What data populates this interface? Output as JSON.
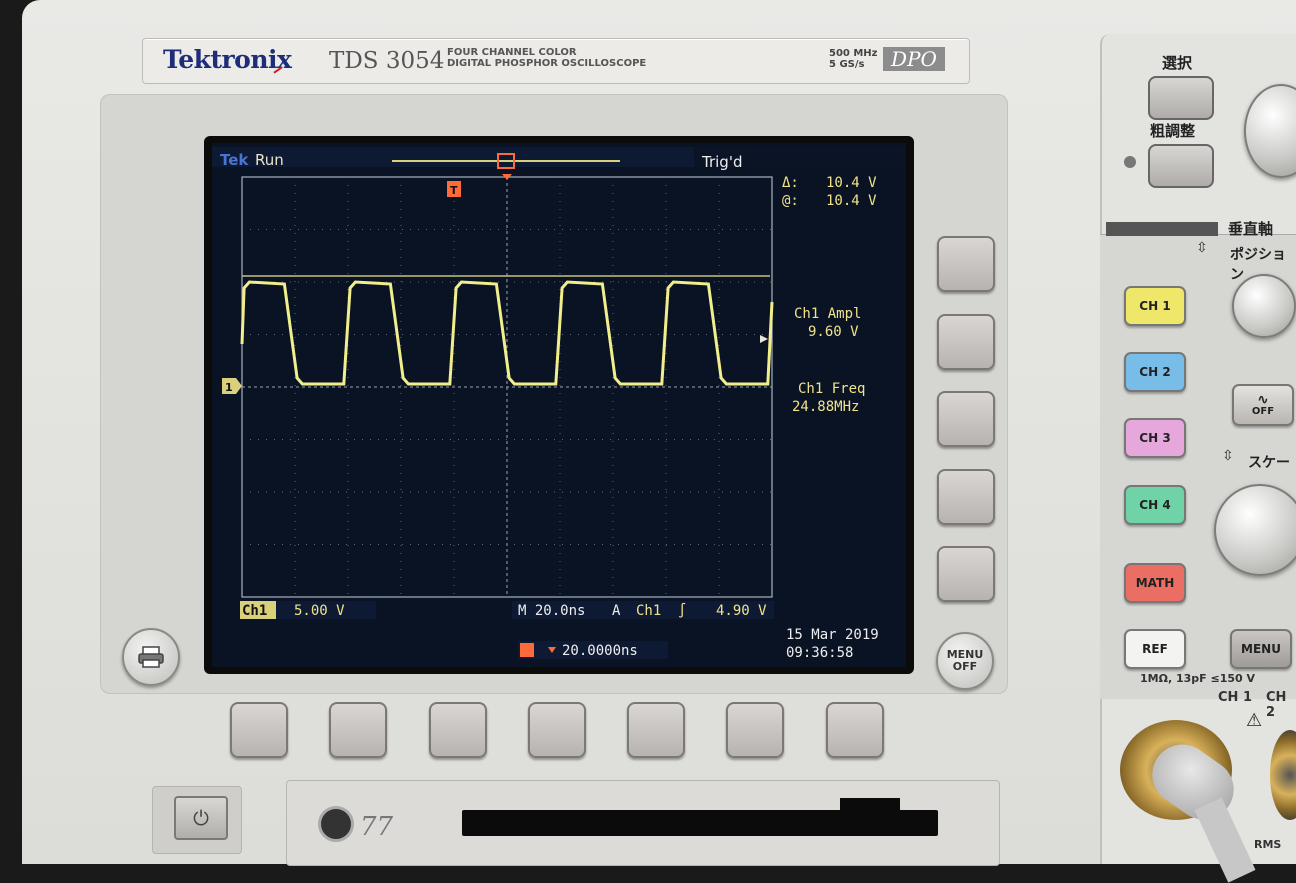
{
  "device": {
    "brand": "Tektronix",
    "model": "TDS 3054",
    "description_line1": "FOUR CHANNEL COLOR",
    "description_line2": "DIGITAL PHOSPHOR OSCILLOSCOPE",
    "spec_line1": "500 MHz",
    "spec_line2": "5 GS/s",
    "badge": "DPO"
  },
  "screen": {
    "brand": "Tek",
    "acq_state": "Run",
    "trigger_state": "Trig'd",
    "trigger_marker": "T",
    "channel_marker": "1",
    "delta_label": "Δ:",
    "delta_value": "10.4 V",
    "at_label": "@:",
    "at_value": "10.4 V",
    "meas1_label": "Ch1 Ampl",
    "meas1_value": "9.60 V",
    "meas2_label": "Ch1 Freq",
    "meas2_value": "24.88MHz",
    "ch1_label": "Ch1",
    "ch1_scale": "5.00 V",
    "timebase": "M 20.0ns",
    "trig_source_prefix": "A",
    "trig_source": "Ch1",
    "trig_slope": "∫",
    "trig_level": "4.90 V",
    "trig_position": "20.0000ns",
    "date": "15 Mar 2019",
    "time": "09:36:58",
    "colors": {
      "trace": "#f1ee8c",
      "text": "#f0e38a",
      "grid": "#7a8090",
      "bg": "#0a1324",
      "accent": "#ff6a3a"
    }
  },
  "waveform": {
    "type": "square",
    "channel": "Ch1",
    "frequency_mhz": 24.88,
    "amplitude_v": 9.6,
    "cycles_visible": 5
  },
  "buttons": {
    "menu_off": "MENU\nOFF",
    "select": "選択",
    "fine": "粗調整",
    "vertical": "垂直軸",
    "position": "ポジション",
    "scale": "スケー",
    "off": "OFF",
    "ch1": "CH 1",
    "ch2": "CH 2",
    "ch3": "CH 3",
    "ch4": "CH 4",
    "math": "MATH",
    "ref": "REF",
    "menu": "MENU",
    "input_spec": "1MΩ, 13pF ≤150 V",
    "input_ch1": "CH 1",
    "input_ch2": "CH 2",
    "rms": "RMS"
  },
  "icons": [
    "printer-icon",
    "power-icon",
    "trigger-slope-icon",
    "warning-icon"
  ]
}
